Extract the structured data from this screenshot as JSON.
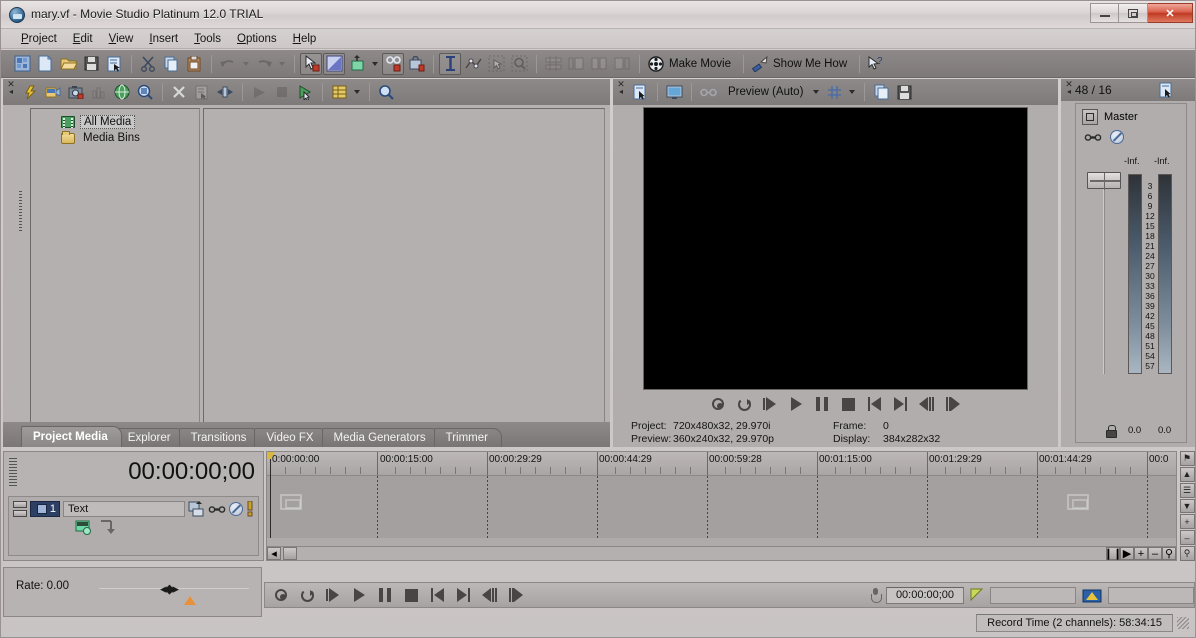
{
  "window": {
    "title": "mary.vf - Movie Studio Platinum 12.0 TRIAL",
    "app_icon": "movie-studio-icon",
    "minimize": "—",
    "maximize": "❐",
    "close": "✕"
  },
  "menu": {
    "items": [
      {
        "label": "Project",
        "accel": "P"
      },
      {
        "label": "Edit",
        "accel": "E"
      },
      {
        "label": "View",
        "accel": "V"
      },
      {
        "label": "Insert",
        "accel": "I"
      },
      {
        "label": "Tools",
        "accel": "T"
      },
      {
        "label": "Options",
        "accel": "O"
      },
      {
        "label": "Help",
        "accel": "H"
      }
    ]
  },
  "toolbar": {
    "buttons": [
      {
        "name": "new-project-icon",
        "enabled": true
      },
      {
        "name": "new-blank-project-icon",
        "enabled": true
      },
      {
        "name": "open-project-icon",
        "enabled": true
      },
      {
        "name": "save-project-icon",
        "enabled": true
      },
      {
        "name": "project-properties-icon",
        "enabled": true
      },
      {
        "name": "cut-icon",
        "enabled": true
      },
      {
        "name": "copy-icon",
        "enabled": true
      },
      {
        "name": "paste-icon",
        "enabled": true
      },
      {
        "name": "undo-icon",
        "enabled": false
      },
      {
        "name": "redo-icon",
        "enabled": false
      },
      {
        "name": "enable-snapping-icon",
        "enabled": true
      },
      {
        "name": "auto-ripple-icon",
        "enabled": true
      },
      {
        "name": "insert-text-media-icon",
        "enabled": true
      },
      {
        "name": "automatic-crossfades-icon",
        "enabled": true
      },
      {
        "name": "lock-envelopes-icon",
        "enabled": true
      },
      {
        "name": "normal-edit-tool-icon",
        "enabled": true
      },
      {
        "name": "envelope-edit-tool-icon",
        "enabled": true
      },
      {
        "name": "selection-edit-tool-icon",
        "enabled": true
      },
      {
        "name": "zoom-edit-tool-icon",
        "enabled": true
      },
      {
        "name": "align-tracks-icon",
        "enabled": false
      },
      {
        "name": "align-left-icon",
        "enabled": false
      },
      {
        "name": "align-center-icon",
        "enabled": false
      },
      {
        "name": "align-right-icon",
        "enabled": false
      }
    ],
    "make_movie_label": "Make Movie",
    "show_me_how_label": "Show Me How",
    "whats_this_icon": "whats-this-help-icon"
  },
  "media_panel": {
    "toolbar_icons": [
      "import-media-icon",
      "capture-video-icon",
      "get-photo-icon",
      "extract-audio-cd-icon",
      "get-media-from-web-icon",
      "media-properties-icon",
      "remove-from-project-icon",
      "media-file-properties-icon",
      "add-to-timeline-icon",
      "start-preview-icon",
      "stop-preview-icon",
      "auto-preview-icon",
      "views-icon",
      "search-media-icon"
    ],
    "tree": [
      {
        "label": "All Media",
        "icon": "film-icon",
        "selected": true
      },
      {
        "label": "Media Bins",
        "icon": "folder-icon",
        "selected": false
      }
    ],
    "tabs": [
      {
        "label": "Project Media",
        "active": true
      },
      {
        "label": "Explorer",
        "active": false
      },
      {
        "label": "Transitions",
        "active": false
      },
      {
        "label": "Video FX",
        "active": false
      },
      {
        "label": "Media Generators",
        "active": false
      },
      {
        "label": "Trimmer",
        "active": false
      }
    ]
  },
  "preview": {
    "toolbar": {
      "properties_icon": "video-preview-properties-icon",
      "display_icon": "preview-on-external-monitor-icon",
      "split_icon": "split-screen-view-icon",
      "quality_label": "Preview (Auto)",
      "quality_caret": "▼",
      "overlays_icon": "overlays-grid-icon",
      "overlays_caret": "▼",
      "copy_snapshot_icon": "copy-snapshot-to-clipboard-icon",
      "save_snapshot_icon": "save-snapshot-to-file-icon"
    },
    "transport": [
      "record-icon",
      "loop-playback-icon",
      "play-from-start-icon",
      "play-icon",
      "pause-icon",
      "stop-icon",
      "go-to-start-icon",
      "go-to-end-icon",
      "previous-frame-icon",
      "next-frame-icon"
    ],
    "status": {
      "project_label": "Project:",
      "project_value": "720x480x32, 29.970i",
      "preview_label": "Preview:",
      "preview_value": "360x240x32, 29.970p",
      "frame_label": "Frame:",
      "frame_value": "0",
      "display_label": "Display:",
      "display_value": "384x282x32"
    }
  },
  "mixer": {
    "header": "48 / 16",
    "properties_icon": "mixer-properties-icon",
    "master_label": "Master",
    "master_icon": "master-bus-icon",
    "fade_icon": "fade-to-color-icon",
    "mute_icon": "mute-icon",
    "inf_left": "-Inf.",
    "inf_right": "-Inf.",
    "scale": [
      "3",
      "6",
      "9",
      "12",
      "15",
      "18",
      "21",
      "24",
      "27",
      "30",
      "33",
      "36",
      "39",
      "42",
      "45",
      "48",
      "51",
      "54",
      "57"
    ],
    "lock_icon": "lock-fader-icon",
    "value_left": "0.0",
    "value_right": "0.0"
  },
  "timeline": {
    "timecode": "00:00:00;00",
    "track": {
      "number": "1",
      "name": "Text",
      "icons": [
        "track-fx-icon",
        "fade-to-color-icon",
        "mute-icon",
        "solo-icon",
        "track-motion-icon",
        "compositing-mode-icon"
      ]
    },
    "ruler_labels": [
      "0:00:00:00",
      "00:00:15:00",
      "00:00:29:29",
      "00:00:44:29",
      "00:00:59:28",
      "00:01:15:00",
      "00:01:29:29",
      "00:01:44:29",
      "00:0"
    ],
    "right_rail": [
      "marker-icon",
      "scroll-up-icon",
      "track-list-icon",
      "scroll-down-icon",
      "zoom-in-icon",
      "zoom-out-icon",
      "zoom-tool-icon"
    ],
    "zoom_buttons": [
      "pause-icon",
      "play-icon",
      "zoom-in-icon",
      "zoom-out-icon",
      "zoom-tool-icon"
    ]
  },
  "rate": {
    "label": "Rate: 0.00",
    "scrub_icon": "scrub-control-icon",
    "marker_icon": "rate-marker-icon"
  },
  "bottom_bar": {
    "transport": [
      "record-icon",
      "loop-playback-icon",
      "play-from-start-icon",
      "play-icon",
      "pause-icon",
      "stop-icon",
      "go-to-start-icon",
      "go-to-end-icon",
      "previous-frame-icon",
      "next-frame-icon"
    ],
    "mic_icon": "record-input-icon",
    "timecode": "00:00:00;00",
    "meter_icon": "record-meter-icon",
    "folder_icon": "record-folder-icon"
  },
  "statusbar": {
    "record_time": "Record Time (2 channels): 58:34:15"
  },
  "colors": {
    "accent_blue": "#2d3f63",
    "close_red": "#bf3a23",
    "rate_marker_orange": "#e8913c",
    "playhead_gold": "#d8b840"
  }
}
